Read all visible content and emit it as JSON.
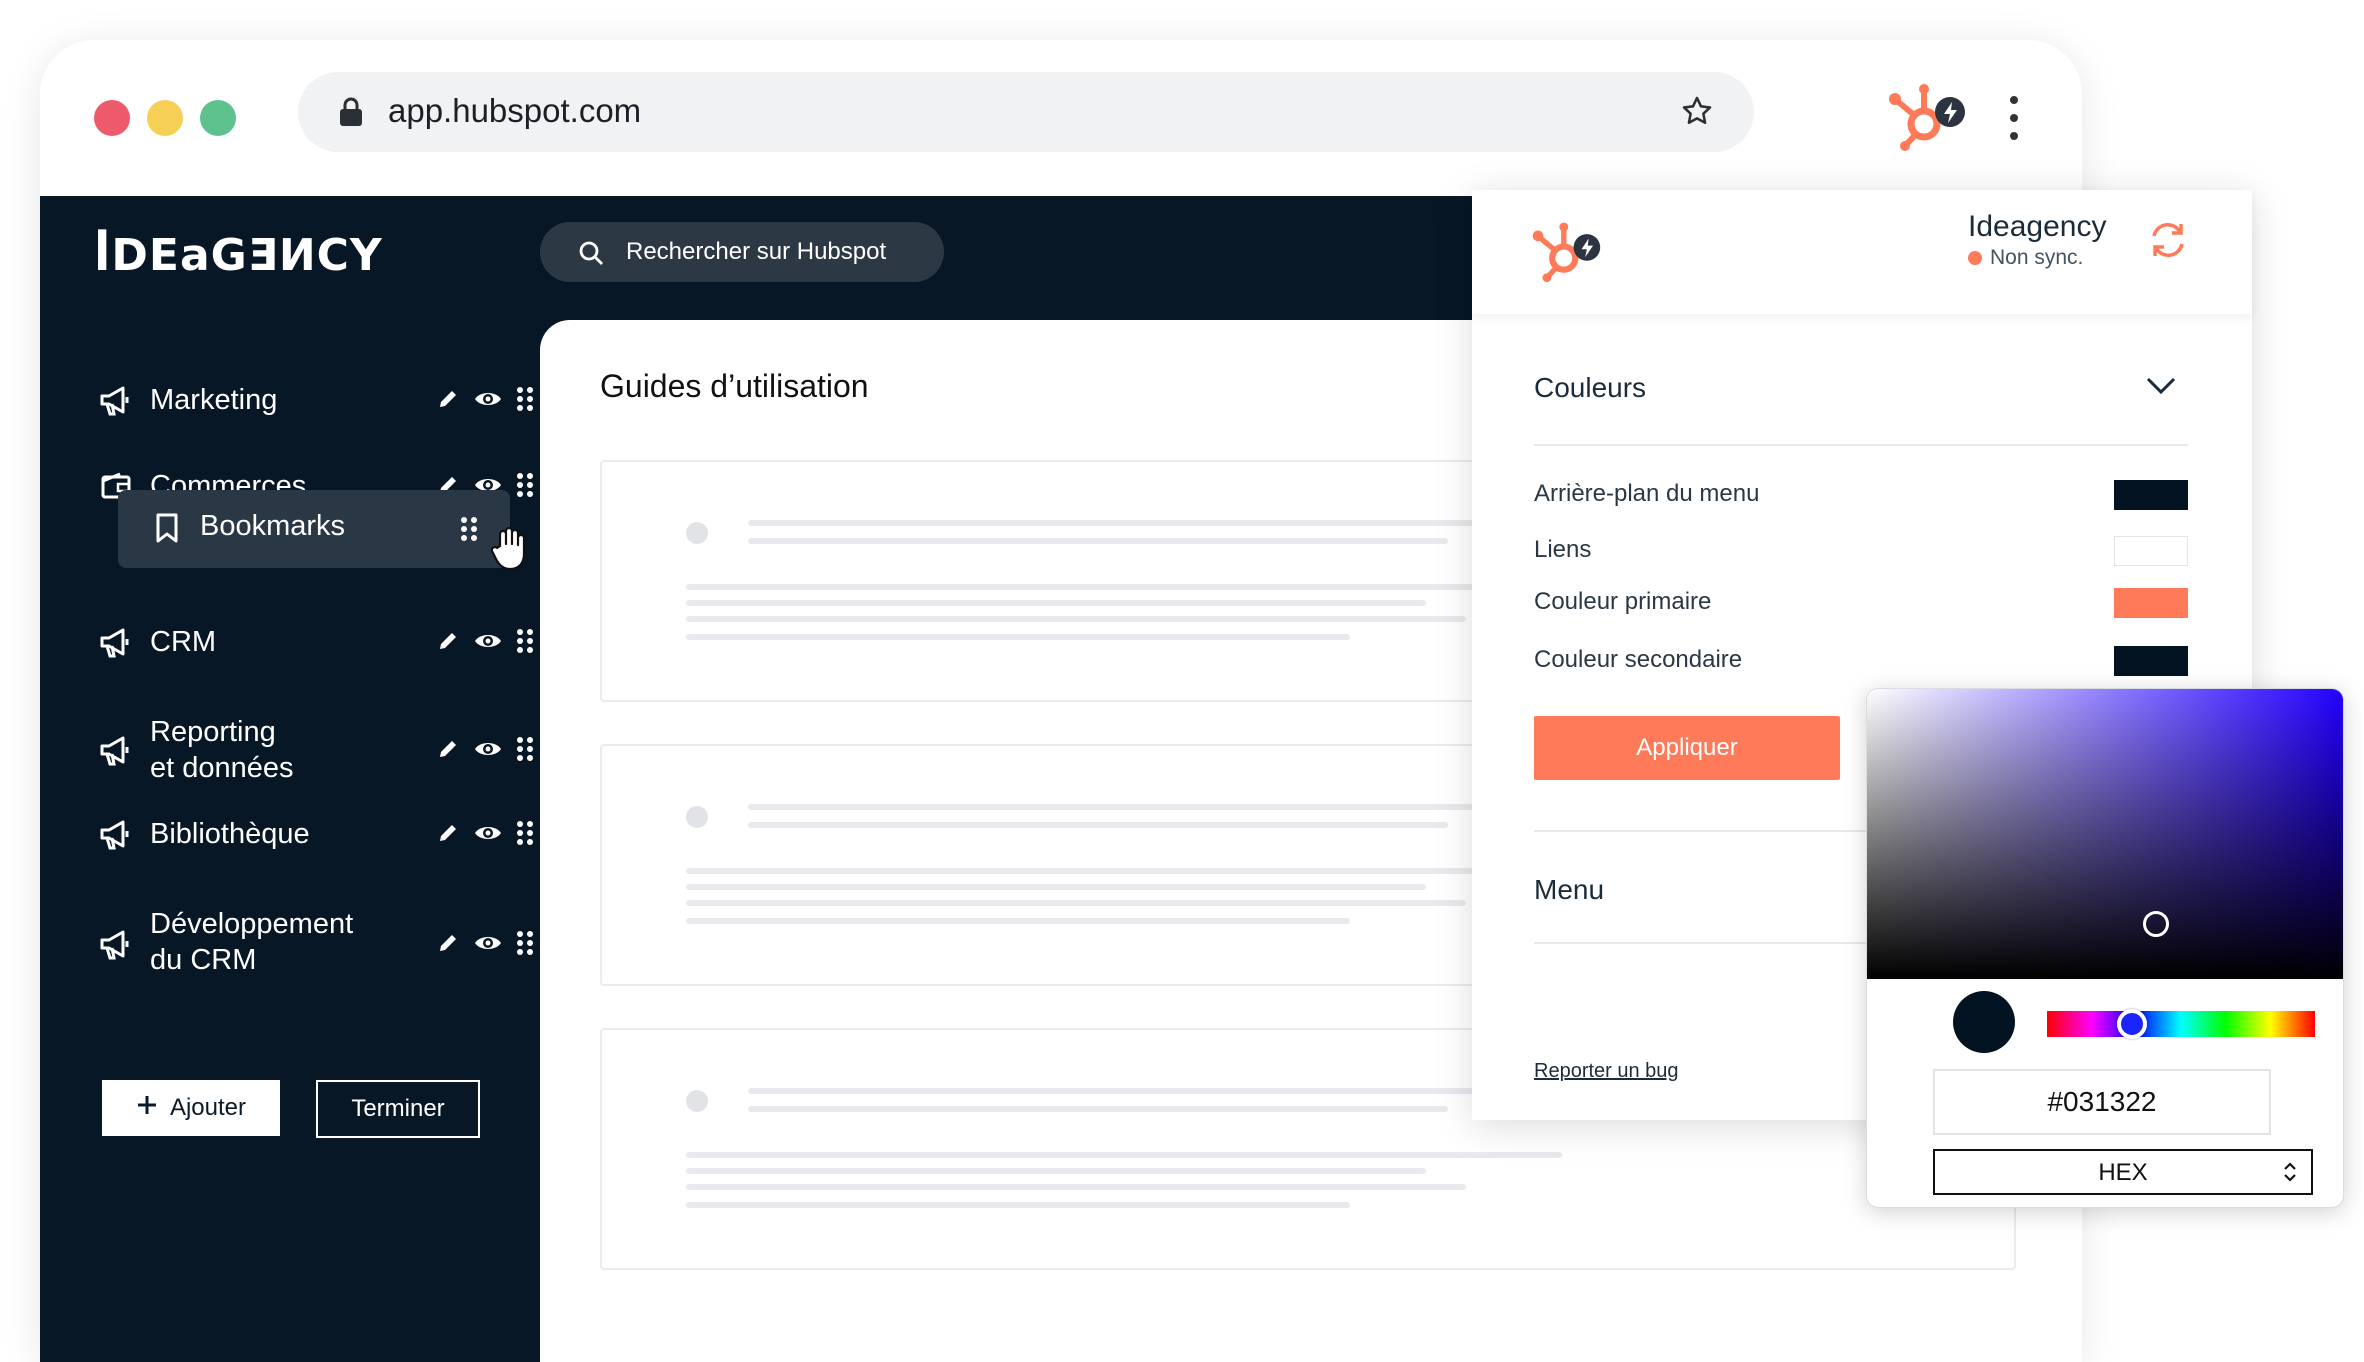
{
  "browser": {
    "url": "app.hubspot.com"
  },
  "app": {
    "logo": "ꟾDEaGƎИCY",
    "search_placeholder": "Rechercher sur Hubspot",
    "sidebar": {
      "items": [
        {
          "label": "Marketing"
        },
        {
          "label": "Commerces"
        },
        {
          "label": "Bookmarks"
        },
        {
          "label": "CRM"
        },
        {
          "label": "Reporting\net données"
        },
        {
          "label": "Bibliothèque"
        },
        {
          "label": "Développement\ndu CRM"
        }
      ],
      "add_label": "Ajouter",
      "done_label": "Terminer"
    },
    "content": {
      "title": "Guides d’utilisation"
    }
  },
  "panel": {
    "account_name": "Ideagency",
    "account_status": "Non sync.",
    "colors_section": "Couleurs",
    "colors": [
      {
        "label": "Arrière-plan du menu",
        "value": "#031322"
      },
      {
        "label": "Liens",
        "value": "#ffffff"
      },
      {
        "label": "Couleur primaire",
        "value": "#ff7a59"
      },
      {
        "label": "Couleur secondaire",
        "value": "#031322"
      }
    ],
    "apply_label": "Appliquer",
    "menu_section": "Menu",
    "bug_link": "Reporter un bug"
  },
  "picker": {
    "hex_value": "#031322",
    "format": "HEX"
  },
  "colors": {
    "accent": "#ff7a59",
    "app_bg": "#071726"
  }
}
